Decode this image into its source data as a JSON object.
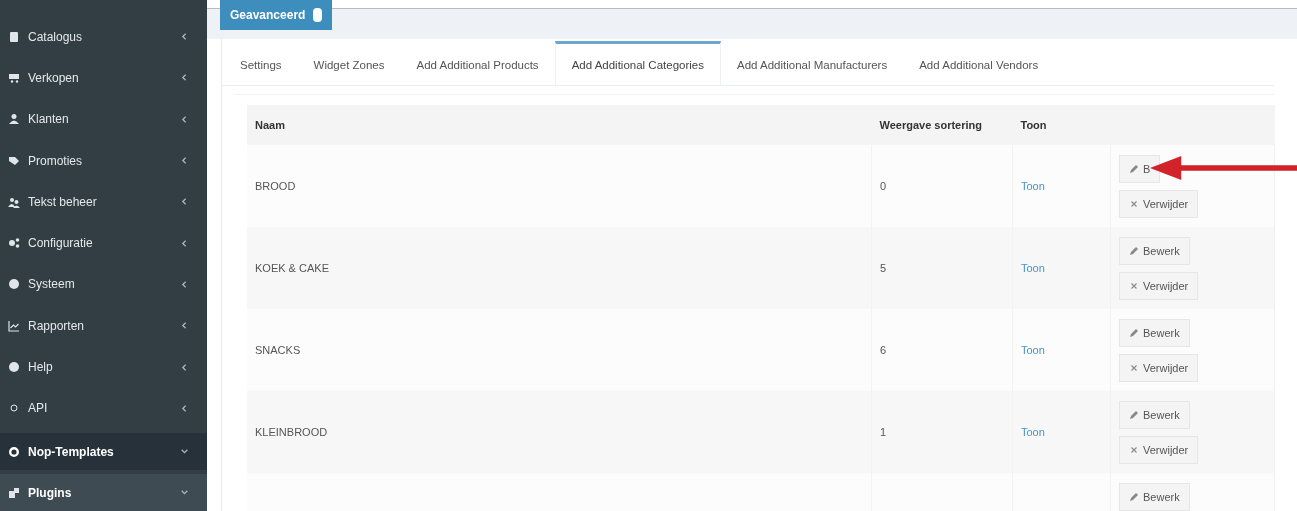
{
  "sidebar": {
    "items": [
      {
        "label": "Catalogus",
        "expanded": false,
        "selected": false
      },
      {
        "label": "Verkopen",
        "expanded": false,
        "selected": false
      },
      {
        "label": "Klanten",
        "expanded": false,
        "selected": false
      },
      {
        "label": "Promoties",
        "expanded": false,
        "selected": false
      },
      {
        "label": "Tekst beheer",
        "expanded": false,
        "selected": false
      },
      {
        "label": "Configuratie",
        "expanded": false,
        "selected": false
      },
      {
        "label": "Systeem",
        "expanded": false,
        "selected": false
      },
      {
        "label": "Rapporten",
        "expanded": false,
        "selected": false
      },
      {
        "label": "Help",
        "expanded": false,
        "selected": false
      },
      {
        "label": "API",
        "expanded": false,
        "selected": false
      },
      {
        "label": "Nop-Templates",
        "expanded": true,
        "selected": false
      },
      {
        "label": "Plugins",
        "expanded": true,
        "selected": true
      }
    ]
  },
  "advanced_button": {
    "label": "Geavanceerd"
  },
  "tabs": [
    {
      "label": "Settings",
      "selected": false
    },
    {
      "label": "Widget Zones",
      "selected": false
    },
    {
      "label": "Add Additional Products",
      "selected": false
    },
    {
      "label": "Add Additional Categories",
      "selected": true
    },
    {
      "label": "Add Additional Manufacturers",
      "selected": false
    },
    {
      "label": "Add Additional Vendors",
      "selected": false
    }
  ],
  "table": {
    "columns": [
      "Naam",
      "Weergave sortering",
      "Toon"
    ],
    "rows": [
      {
        "name": "BROOD",
        "order": "0",
        "show": "Toon",
        "edit": "B",
        "delete": "Verwijder"
      },
      {
        "name": "KOEK & CAKE",
        "order": "5",
        "show": "Toon",
        "edit": "Bewerk",
        "delete": "Verwijder"
      },
      {
        "name": "SNACKS",
        "order": "6",
        "show": "Toon",
        "edit": "Bewerk",
        "delete": "Verwijder"
      },
      {
        "name": "KLEINBROOD",
        "order": "1",
        "show": "Toon",
        "edit": "Bewerk",
        "delete": "Verwijder"
      },
      {
        "edit": "Bewerk"
      }
    ]
  }
}
